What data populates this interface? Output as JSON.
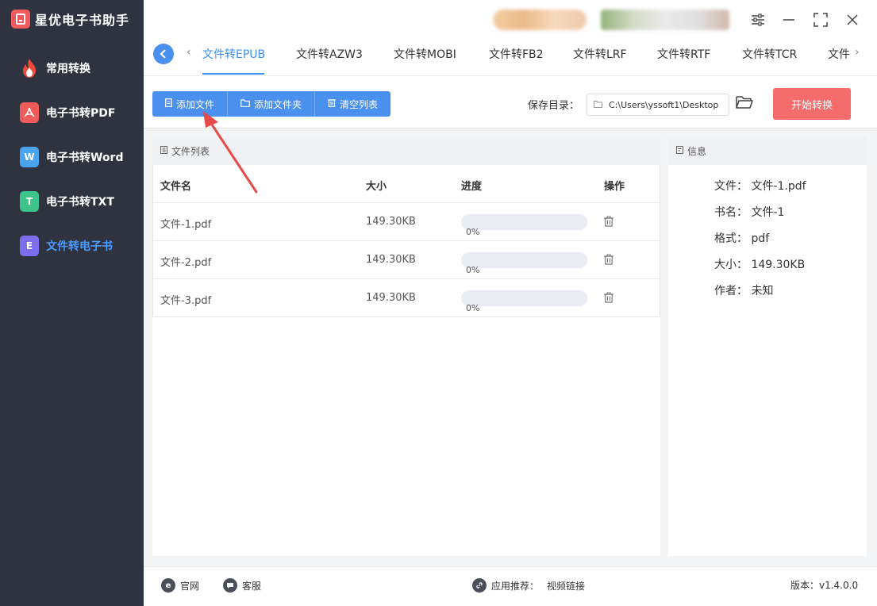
{
  "app": {
    "title": "星优电子书助手"
  },
  "sidebar": {
    "items": [
      {
        "label": "常用转换",
        "icon": "flame-icon",
        "color": "#f04a3a"
      },
      {
        "label": "电子书转PDF",
        "icon": "pdf-icon",
        "glyph": "ᕗ",
        "color": "#ef5b5b"
      },
      {
        "label": "电子书转Word",
        "icon": "word-icon",
        "glyph": "W",
        "color": "#4aa3ef"
      },
      {
        "label": "电子书转TXT",
        "icon": "txt-icon",
        "glyph": "T",
        "color": "#3cc48a"
      },
      {
        "label": "文件转电子书",
        "icon": "ebook-icon",
        "glyph": "E",
        "color": "#7b6ff0",
        "active": true
      }
    ]
  },
  "tabs": [
    {
      "label": "文件转EPUB",
      "active": true
    },
    {
      "label": "文件转AZW3"
    },
    {
      "label": "文件转MOBI"
    },
    {
      "label": "文件转FB2"
    },
    {
      "label": "文件转LRF"
    },
    {
      "label": "文件转RTF"
    },
    {
      "label": "文件转TCR"
    },
    {
      "label": "文件转"
    }
  ],
  "toolbar": {
    "add_file": "添加文件",
    "add_folder": "添加文件夹",
    "clear_list": "清空列表",
    "save_dir_label": "保存目录：",
    "save_dir_value": "C:\\Users\\yssoft1\\Desktop",
    "start": "开始转换"
  },
  "file_list": {
    "title": "文件列表",
    "columns": {
      "name": "文件名",
      "size": "大小",
      "progress": "进度",
      "action": "操作"
    },
    "rows": [
      {
        "name": "文件-1.pdf",
        "size": "149.30KB",
        "progress_text": "0%",
        "progress": 0
      },
      {
        "name": "文件-2.pdf",
        "size": "149.30KB",
        "progress_text": "0%",
        "progress": 0
      },
      {
        "name": "文件-3.pdf",
        "size": "149.30KB",
        "progress_text": "0%",
        "progress": 0
      }
    ]
  },
  "info": {
    "title": "信息",
    "file": "文件：  文件-1.pdf",
    "book_name": "书名：  文件-1",
    "format": "格式：  pdf",
    "size": "大小：  149.30KB",
    "author": "作者：  未知"
  },
  "bottom": {
    "website": "官网",
    "support": "客服",
    "recommend_label": "应用推荐：",
    "recommend_link": "视频链接",
    "version": "版本：v1.4.0.0"
  },
  "colors": {
    "accent": "#4a90ef",
    "start": "#f56c6c",
    "sidebar": "#2f3340",
    "active_nav": "#4b9bff"
  }
}
